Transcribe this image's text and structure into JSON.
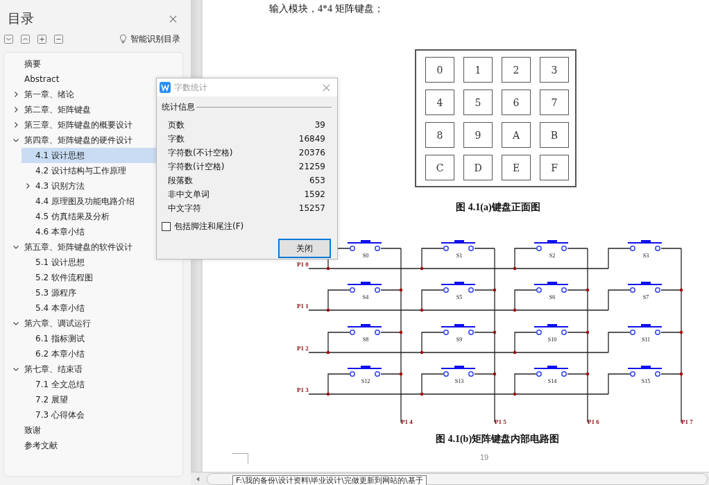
{
  "sidebar": {
    "title": "目录",
    "smart_toc": "智能识别目录",
    "items": [
      {
        "label": "摘要",
        "selected": false
      },
      {
        "label": "Abstract",
        "selected": false
      },
      {
        "label": "第一章、绪论",
        "selected": false,
        "expanded": false
      },
      {
        "label": "第二章、矩阵键盘",
        "selected": false,
        "expanded": false
      },
      {
        "label": "第三章、矩阵键盘的概要设计",
        "selected": false,
        "expanded": false
      },
      {
        "label": "第四章、矩阵键盘的硬件设计",
        "selected": false,
        "expanded": true,
        "children": [
          {
            "label": "4.1 设计思想",
            "selected": true
          },
          {
            "label": "4.2 设计结构与工作原理",
            "selected": false
          },
          {
            "label": "4.3 识别方法",
            "selected": false,
            "expanded": false
          },
          {
            "label": "4.4 原理图及功能电路介绍",
            "selected": false
          },
          {
            "label": "4.5 仿真结果及分析",
            "selected": false
          },
          {
            "label": "4.6 本章小结",
            "selected": false
          }
        ]
      },
      {
        "label": "第五章、矩阵键盘的软件设计",
        "selected": false,
        "expanded": true,
        "children": [
          {
            "label": "5.1 设计思想",
            "selected": false
          },
          {
            "label": "5.2 软件流程图",
            "selected": false
          },
          {
            "label": "5.3 源程序",
            "selected": false
          },
          {
            "label": "5.4 本章小结",
            "selected": false
          }
        ]
      },
      {
        "label": "第六章、调试运行",
        "selected": false,
        "expanded": true,
        "children": [
          {
            "label": "6.1 指标测试",
            "selected": false
          },
          {
            "label": "6.2 本章小结",
            "selected": false
          }
        ]
      },
      {
        "label": "第七章、结束语",
        "selected": false,
        "expanded": true,
        "children": [
          {
            "label": "7.1 全文总结",
            "selected": false
          },
          {
            "label": "7.2 展望",
            "selected": false
          },
          {
            "label": "7.3 心得体会",
            "selected": false
          }
        ]
      },
      {
        "label": "致谢",
        "selected": false
      },
      {
        "label": "参考文献",
        "selected": false
      }
    ]
  },
  "document": {
    "intro_text": "输入模块，4*4 矩阵键盘；",
    "keypad_keys": [
      "0",
      "1",
      "2",
      "3",
      "4",
      "5",
      "6",
      "7",
      "8",
      "9",
      "A",
      "B",
      "C",
      "D",
      "E",
      "F"
    ],
    "figure_a_caption": "图 4.1(a)键盘正面图",
    "circuit": {
      "row_ports": [
        "P1 0",
        "P1 1",
        "P1 2",
        "P1 3"
      ],
      "column_ports": [
        "P1 4",
        "P1 5",
        "P1 6",
        "P1 7"
      ],
      "switches": [
        "S0",
        "S1",
        "S2",
        "S3",
        "S4",
        "S5",
        "S6",
        "S7",
        "S8",
        "S9",
        "S10",
        "S11",
        "S12",
        "S13",
        "S14",
        "S15"
      ]
    },
    "figure_b_caption": "图 4.1(b)矩阵键盘内部电路图",
    "page_number": "19"
  },
  "tooltip": "F:\\我的备份\\设计资料\\毕业设计\\完做更新到网站的\\基于",
  "dialog": {
    "title": "字数统计",
    "group": "统计信息",
    "stats": [
      {
        "label": "页数",
        "value": "39"
      },
      {
        "label": "字数",
        "value": "16849"
      },
      {
        "label": "字符数(不计空格)",
        "value": "20376"
      },
      {
        "label": "字符数(计空格)",
        "value": "21259"
      },
      {
        "label": "段落数",
        "value": "653"
      },
      {
        "label": "非中文单词",
        "value": "1592"
      },
      {
        "label": "中文字符",
        "value": "15257"
      }
    ],
    "include_notes": {
      "label": "包括脚注和尾注(F)",
      "checked": false
    },
    "close_button": "关闭"
  }
}
